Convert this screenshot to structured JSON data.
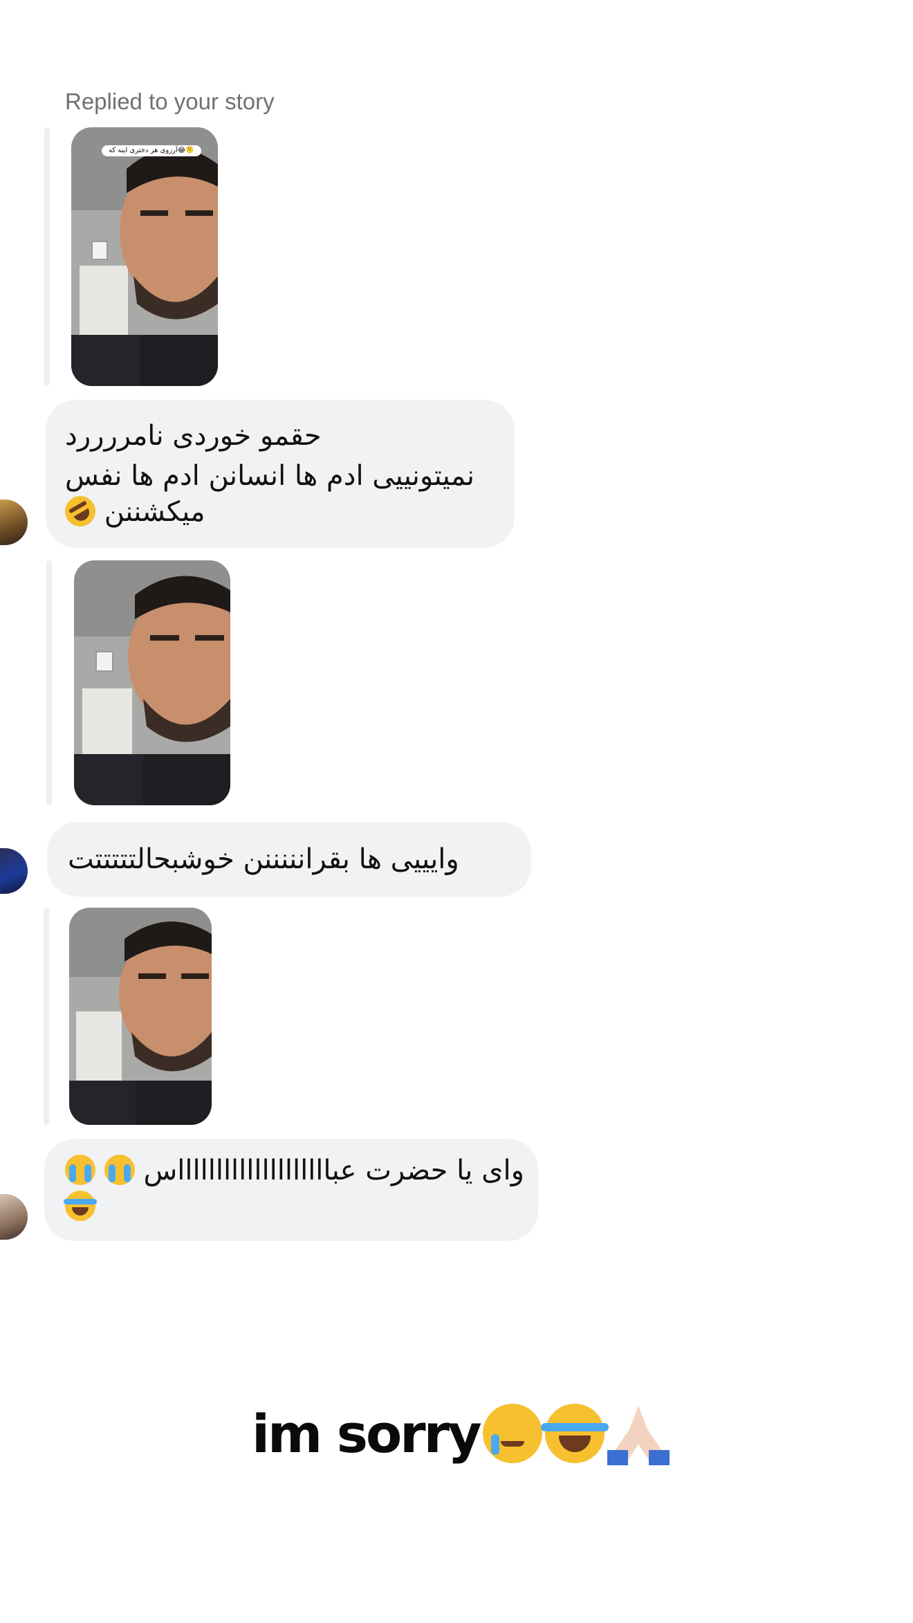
{
  "header": {
    "reply_label": "Replied to your story"
  },
  "stories": [
    {
      "overlay_text": "آرزوی هر دختری اینه که😂🫠"
    },
    {
      "overlay_text": ""
    },
    {
      "overlay_text": ""
    }
  ],
  "messages": [
    {
      "lines": [
        "حقمو خوردی نامررررد",
        "نمیتونییی ادم ها انسانن ادم ها نفس",
        "میکشننن"
      ],
      "emoji": [
        "rolling-on-floor-laughing"
      ]
    },
    {
      "lines": [
        "وایییی ها بقرانننننن خوشبحالتتتتتت"
      ],
      "emoji": []
    },
    {
      "lines": [
        "وای یا حضرت عبااااااااااااااااااااس"
      ],
      "emoji": [
        "loudly-crying",
        "loudly-crying",
        "face-with-tears-of-joy"
      ]
    }
  ],
  "sticker": {
    "text": "im sorry",
    "emoji": [
      "smiling-face-with-tear",
      "face-with-tears-of-joy",
      "folded-hands"
    ]
  },
  "colors": {
    "bubble": "#f1f2f4",
    "label": "#6e7074",
    "reply_line": "#eeeff1"
  }
}
